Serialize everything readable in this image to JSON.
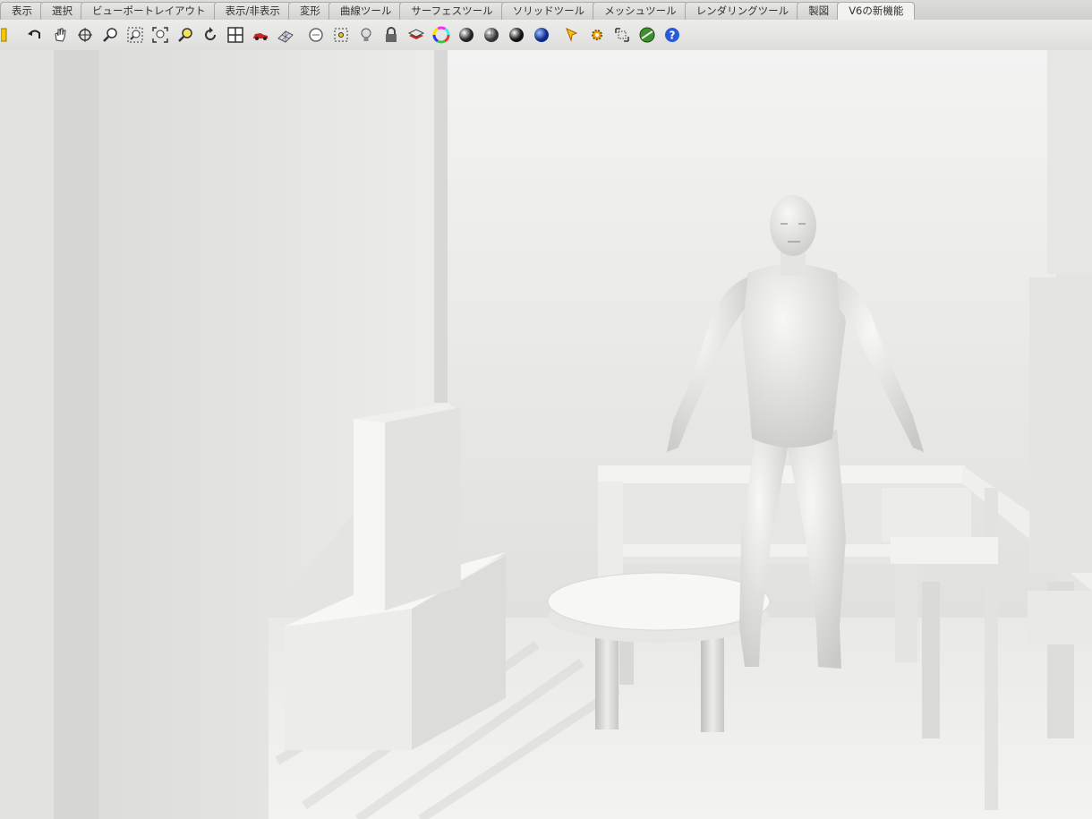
{
  "menu_tabs": [
    {
      "label": "表示"
    },
    {
      "label": "選択"
    },
    {
      "label": "ビューポートレイアウト"
    },
    {
      "label": "表示/非表示"
    },
    {
      "label": "変形"
    },
    {
      "label": "曲線ツール"
    },
    {
      "label": "サーフェスツール"
    },
    {
      "label": "ソリッドツール"
    },
    {
      "label": "メッシュツール"
    },
    {
      "label": "レンダリングツール"
    },
    {
      "label": "製図"
    },
    {
      "label": "V6の新機能"
    }
  ],
  "toolbar_icons": [
    "new-file-icon",
    "undo-icon",
    "pan-hand-icon",
    "rotate-view-icon",
    "zoom-dynamic-icon",
    "zoom-window-icon",
    "zoom-extents-icon",
    "zoom-selected-icon",
    "rotate-icon",
    "four-viewports-icon",
    "car-icon",
    "grid-icon",
    "circle-option-icon",
    "points-icon",
    "light-bulb-icon",
    "lock-icon",
    "layer-icon",
    "color-wheel-icon",
    "shaded-sphere-icon",
    "rendered-sphere-icon",
    "material-sphere-icon",
    "render-icon",
    "settings-gear-icon",
    "dimension-icon",
    "globe-icon",
    "help-icon"
  ],
  "colors": {
    "ui_background": "#e9e9e7",
    "viewport_background": "#e4e4e2",
    "help_icon_blue": "#2a5bd6",
    "render_sphere_blue": "#1c3fb3"
  }
}
